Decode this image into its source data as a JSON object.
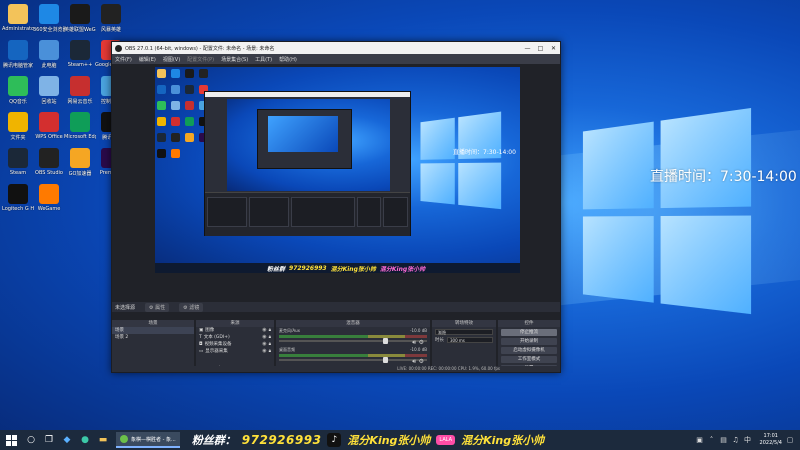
{
  "desktop": {
    "overlay_text": "直播时间：7:30-14:00",
    "icons": [
      {
        "label": "Administrator",
        "icon": "folder-icon",
        "color": "#f3c35a"
      },
      {
        "label": "360安全浏览器",
        "icon": "browser-icon",
        "color": "#1e88e5"
      },
      {
        "label": "英雄联盟WeGame",
        "icon": "lol-icon",
        "color": "#1a1a1a"
      },
      {
        "label": "风暴英雄",
        "icon": "game-icon",
        "color": "#222"
      },
      {
        "label": "腾讯电脑管家",
        "icon": "shield-icon",
        "color": "#1565c0"
      },
      {
        "label": "此电脑",
        "icon": "computer-icon",
        "color": "#4a90d9"
      },
      {
        "label": "Steam++",
        "icon": "steam-plus-icon",
        "color": "#1b2838"
      },
      {
        "label": "Google Chrome",
        "icon": "chrome-icon",
        "color": "#e53935"
      },
      {
        "label": "QQ音乐",
        "icon": "music-icon",
        "color": "#2ebd59"
      },
      {
        "label": "回收站",
        "icon": "recycle-bin-icon",
        "color": "#7fb3e6"
      },
      {
        "label": "网易云音乐",
        "icon": "netease-icon",
        "color": "#c62f2f"
      },
      {
        "label": "控制面板",
        "icon": "control-panel-icon",
        "color": "#4aa3df"
      },
      {
        "label": "文件夹",
        "icon": "folder-icon",
        "color": "#f0b400"
      },
      {
        "label": "WPS Office",
        "icon": "wps-icon",
        "color": "#d32f2f"
      },
      {
        "label": "Microsoft Edge",
        "icon": "edge-icon",
        "color": "#0f9d58"
      },
      {
        "label": "腾讯QQ",
        "icon": "qq-icon",
        "color": "#111"
      },
      {
        "label": "Steam",
        "icon": "steam-icon",
        "color": "#1b2838"
      },
      {
        "label": "OBS Studio",
        "icon": "obs-icon",
        "color": "#222"
      },
      {
        "label": "GO加速器",
        "icon": "accelerator-icon",
        "color": "#f5a623"
      },
      {
        "label": "Premiere",
        "icon": "premiere-icon",
        "color": "#2a0a4a"
      },
      {
        "label": "Logitech G HUB",
        "icon": "logitech-icon",
        "color": "#111"
      },
      {
        "label": "WeGame",
        "icon": "wegame-icon",
        "color": "#ff7a00"
      }
    ]
  },
  "obs": {
    "title": "OBS 27.0.1 (64-bit, windows) - 配置文件: 未命名 - 场景: 未命名",
    "menu": [
      "文件(F)",
      "编辑(E)",
      "视图(V)",
      "配置文件(P)",
      "场景集合(S)",
      "工具(T)",
      "帮助(H)"
    ],
    "scene_bar_label": "未选择源",
    "scene_bar_props": "属性",
    "scene_bar_filters": "滤镜",
    "docks": {
      "scenes_title": "场景",
      "scenes": [
        "场景",
        "场景 2"
      ],
      "sources_title": "来源",
      "sources": [
        "图像",
        "文本 (GDI+)",
        "视频采集设备",
        "显示器采集"
      ],
      "mixer_title": "混音器",
      "mixer": [
        {
          "name": "麦克风/Aux",
          "db": "-10.0 dB"
        },
        {
          "name": "桌面音频",
          "db": "-10.0 dB"
        }
      ],
      "transitions_title": "转场特效",
      "transition_type": "渐隐",
      "duration_label": "时长",
      "duration_value": "300 ms",
      "controls_title": "控件",
      "controls": [
        "停止推流",
        "开始录制",
        "启动虚拟摄像机",
        "工作室模式",
        "设置",
        "退出"
      ]
    },
    "status": "LIVE: 00:00:00   REC: 00:00:00   CPU: 1.9%, 60.00 fps"
  },
  "preview_overlay": {
    "fans_label": "粉丝群",
    "fans_number": "972926993",
    "handle": "混分King张小帅"
  },
  "taskbar": {
    "app_label": "象棋—棋胜者 - 象...",
    "fans_label": "粉丝群：",
    "fans_number": "972926993",
    "handle1": "混分King张小帅",
    "handle2": "混分King张小帅",
    "lala": "LALA",
    "time": "17:01",
    "date": "2022/5/4"
  }
}
